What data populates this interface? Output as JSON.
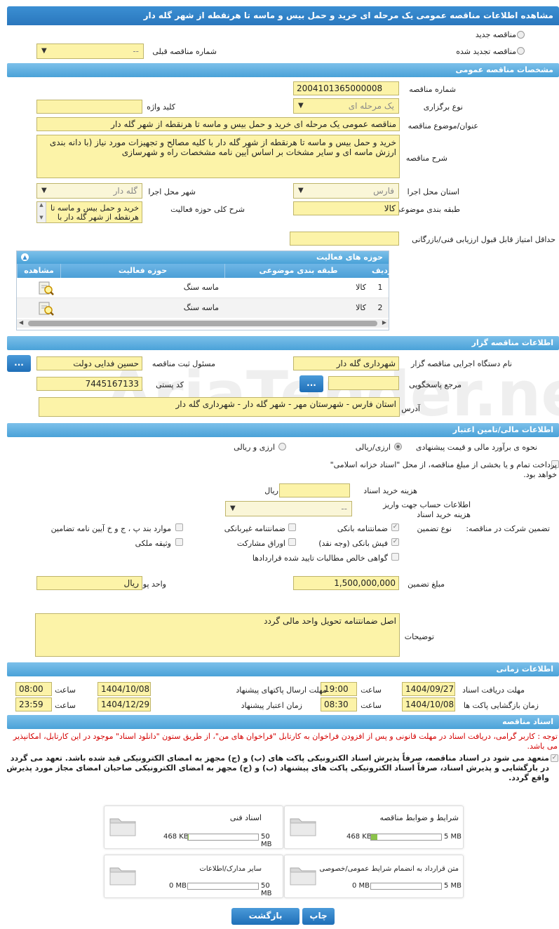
{
  "window": {
    "title": "مشاهده اطلاعات مناقصه عمومی یک مرحله ای خرید و حمل بیس و ماسه تا هرنقطه از شهر گله دار"
  },
  "top": {
    "new_tender": "مناقصه جدید",
    "renewed_tender": "مناقصه تجدید شده",
    "prev_number_label": "شماره مناقصه قبلی",
    "prev_number_value": "--"
  },
  "general": {
    "section_title": "مشخصات مناقصه عمومی",
    "number_label": "شماره مناقصه",
    "number_value": "2004101365000008",
    "type_label": "نوع برگزاری",
    "type_value": "یک مرحله ای",
    "keyword_label": "کلید واژه",
    "keyword_value": "",
    "subject_label": "عنوان/موضوع مناقصه",
    "subject_value": "مناقصه عمومی یک مرحله ای خرید و حمل بیس و ماسه تا هرنقطه از شهر گله دار",
    "desc_label": "شرح مناقصه",
    "desc_value": "خرید و حمل بیس و ماسه تا هرنقطه از شهر گله دار با کلیه مصالح و تجهیزات مورد نیاز (با دانه بندی ارزش ماسه ای و سایر مشخات بر اساس آیین نامه مشخصات راه و شهرسازی",
    "province_label": "استان محل اجرا",
    "province_value": "فارس",
    "city_label": "شهر محل اجرا",
    "city_value": "گله دار",
    "category_label": "طبقه بندی موضوعی",
    "category_value": "کالا",
    "scope_label": "شرح کلی حوزه فعالیت",
    "scope_value": "خرید و حمل بیس و ماسه تا هرنقطه از شهر گله دار با",
    "min_score_label": "حداقل امتیاز قابل قبول ارزیابی فنی/بازرگانی",
    "min_score_value": ""
  },
  "activity": {
    "title": "حوزه های فعالیت",
    "headers": {
      "row": "ردیف",
      "category": "طبقه بندی موضوعی",
      "field": "حوزه فعالیت",
      "view": "مشاهده"
    },
    "rows": [
      {
        "row": "1",
        "category": "کالا",
        "field": "ماسه سنگ",
        "view_icon": "magnifier-document-icon"
      },
      {
        "row": "2",
        "category": "کالا",
        "field": "ماسه سنگ",
        "view_icon": "magnifier-document-icon"
      }
    ]
  },
  "organizer": {
    "section_title": "اطلاعات مناقصه گزار",
    "org_label": "نام دستگاه اجرایی مناقصه گزار",
    "org_value": "شهرداری گله دار",
    "responsible_label": "مسئول ثبت مناقصه",
    "responsible_value": "حسین فدایی دولت",
    "ref_label": "مرجع پاسخگویی",
    "ref_value": "",
    "postal_label": "کد پستی",
    "postal_value": "7445167133",
    "address_label": "آدرس",
    "address_value": "استان فارس - شهرستان مهر - شهر گله دار - شهرداری گله دار",
    "more_btn": "..."
  },
  "financial": {
    "section_title": "اطلاعات مالی/تامین اعتبار",
    "estimate_label": "نحوه ی برآورد مالی و قیمت پیشنهادی",
    "opt_currency": "ارزی/ریالی",
    "opt_currency_and_rial": "ارزی و ریالی",
    "treasury_text": "پرداخت تمام و یا بخشی از مبلغ مناقصه، از محل \"اسناد خزانه اسلامی\" خواهد بود.",
    "doc_fee_label": "هزینه خرید اسناد",
    "doc_fee_value": "",
    "doc_fee_unit": "ریال",
    "account_label": "اطلاعات حساب جهت واریز هزینه خرید اسناد",
    "account_value": "--"
  },
  "guarantee": {
    "participation_label": "تضمین شرکت در مناقصه:",
    "type_label": "نوع تضمین",
    "bank": "ضمانتنامه بانکی",
    "nonbank": "ضمانتنامه غیربانکی",
    "clauses": "موارد بند پ ، ج و خ آیین نامه تضامین",
    "cash": "فیش بانکی (وجه نقد)",
    "bonds": "اوراق مشارکت",
    "property": "وثیقه ملکی",
    "claims": "گواهی خالص مطالبات تایید شده قراردادها",
    "amount_label": "مبلغ تضمین",
    "amount_value": "1,500,000,000",
    "currency_label": "واحد پول",
    "currency_value": "ریال",
    "notes_label": "توضیحات",
    "notes_value": "اصل ضمانتنامه تحویل واحد مالی گردد"
  },
  "timing": {
    "section_title": "اطلاعات زمانی",
    "doc_receive_label": "مهلت دریافت اسناد",
    "doc_receive_date": "1404/09/27",
    "doc_receive_time": "19:00",
    "send_label": "مهلت ارسال پاکتهای پیشنهاد",
    "send_date": "1404/10/08",
    "send_time": "08:00",
    "open_label": "زمان بازگشایی پاکت ها",
    "open_date": "1404/10/08",
    "open_time": "08:30",
    "validity_label": "زمان اعتبار پیشنهاد",
    "validity_date": "1404/12/29",
    "validity_time": "23:59",
    "time_label": "ساعت"
  },
  "documents": {
    "section_title": "اسناد مناقصه",
    "notice": "توجه : کاربر گرامی، دریافت اسناد در مهلت قانونی و پس از افزودن فراخوان به کارتابل \"فراخوان های من\"، از طریق ستون \"دانلود اسناد\" موجود در این کارتابل، امکانپذیر می باشد.",
    "commitment": "متعهد می شود در اسناد مناقصه، صرفاً پذیرش اسناد الکترونیکی پاکت های (ب) و (ج) مجهز به امضای الکترونیکی قید شده باشد. تعهد می گردد در بارگشایی و پذیرش اسناد، صرفاً اسناد الکترونیکی پاکت های پیشنهاد (ب) و (ج) مجهز به امضای الکترونیکی صاحبان امضای مجاز مورد پذیرش واقع گردد.",
    "boxes": [
      {
        "title": "شرایط و ضوابط مناقصه",
        "size": "468 KB",
        "max": "5 MB",
        "fill": 0.09
      },
      {
        "title": "اسناد فنی",
        "size": "468 KB",
        "max": "50 MB",
        "fill": 0.01
      },
      {
        "title": "متن قرارداد به انضمام شرایط عمومی/خصوصی",
        "size": "0 MB",
        "max": "5 MB",
        "fill": 0
      },
      {
        "title": "سایر مدارک/اطلاعات",
        "size": "0 MB",
        "max": "50 MB",
        "fill": 0
      }
    ]
  },
  "buttons": {
    "print": "چاپ",
    "back": "بازگشت"
  },
  "colors": {
    "accent": "#2a77bd",
    "field_bg": "#fcf3a8",
    "notice": "#d40000"
  }
}
